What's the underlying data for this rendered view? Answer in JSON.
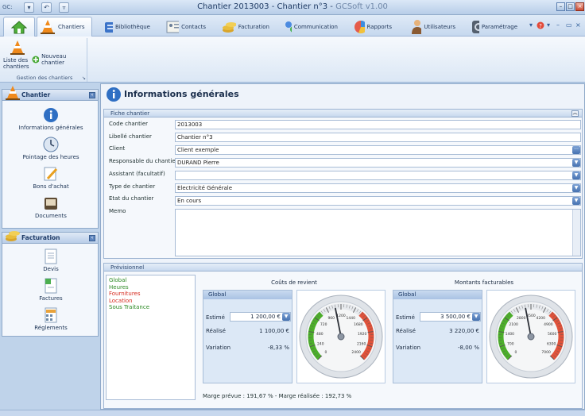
{
  "window": {
    "title": "Chantier 2013003 - Chantier n°3",
    "app_version": "GCSoft v1.00"
  },
  "quick_access": {
    "left_label": "GC:"
  },
  "tabs": [
    {
      "label": "",
      "icon": "home-icon"
    },
    {
      "label": "Chantiers",
      "icon": "cone-icon"
    },
    {
      "label": "Bibliothèque",
      "icon": "library-icon"
    },
    {
      "label": "Contacts",
      "icon": "contacts-icon"
    },
    {
      "label": "Facturation",
      "icon": "coins-icon"
    },
    {
      "label": "Communication",
      "icon": "communication-icon"
    },
    {
      "label": "Rapports",
      "icon": "reports-icon"
    },
    {
      "label": "Utilisateurs",
      "icon": "user-icon"
    },
    {
      "label": "Paramétrage",
      "icon": "settings-icon"
    }
  ],
  "ribbon": {
    "list_button": "Liste des chantiers",
    "new_button": "Nouveau chantier",
    "group_label": "Gestion des chantiers"
  },
  "nav": {
    "chantier_header": "Chantier",
    "chantier_items": [
      "Informations générales",
      "Pointage des heures",
      "Bons d'achat",
      "Documents"
    ],
    "facturation_header": "Facturation",
    "facturation_items": [
      "Devis",
      "Factures",
      "Réglements"
    ]
  },
  "main": {
    "title": "Informations générales",
    "fiche_header": "Fiche chantier",
    "fields": [
      {
        "label": "Code chantier",
        "value": "2013003"
      },
      {
        "label": "Libellé chantier",
        "value": "Chantier n°3"
      },
      {
        "label": "Client",
        "value": "Client exemple"
      },
      {
        "label": "Responsable du chantier",
        "value": "DURAND Pierre"
      },
      {
        "label": "Assistant (facultatif)",
        "value": ""
      },
      {
        "label": "Type de chantier",
        "value": "Electricité Générale"
      },
      {
        "label": "Etat du chantier",
        "value": "En cours"
      }
    ],
    "memo_label": "Memo",
    "previsionnel_header": "Prévisionnel",
    "previsionnel_items": [
      {
        "label": "Global",
        "color": "#2c8a24"
      },
      {
        "label": "Heures",
        "color": "#2c8a24"
      },
      {
        "label": "Fournitures",
        "color": "#d62b1f"
      },
      {
        "label": "Location",
        "color": "#d62b1f"
      },
      {
        "label": "Sous Traitance",
        "color": "#2c8a24"
      }
    ],
    "couts": {
      "title": "Coûts de revient",
      "panel_header": "Global",
      "estime_label": "Estimé",
      "estime_value": "1 200,00 €",
      "realise_label": "Réalisé",
      "realise_value": "1 100,00 €",
      "variation_label": "Variation",
      "variation_value": "-8,33 %",
      "gauge_ticks": [
        "0",
        "240",
        "480",
        "720",
        "960",
        "1200",
        "1440",
        "1680",
        "1920",
        "2160",
        "2400"
      ],
      "gauge_value": 1100,
      "gauge_max": 2400
    },
    "montants": {
      "title": "Montants facturables",
      "panel_header": "Global",
      "estime_label": "Estimé",
      "estime_value": "3 500,00 €",
      "realise_label": "Réalisé",
      "realise_value": "3 220,00 €",
      "variation_label": "Variation",
      "variation_value": "-8,00 %",
      "gauge_ticks": [
        "0",
        "700",
        "1400",
        "2100",
        "2800",
        "3500",
        "4200",
        "4900",
        "5600",
        "6300",
        "7000"
      ],
      "gauge_value": 3220,
      "gauge_max": 7000
    },
    "marge_text": "Marge prévue : 191,67 % - Marge réalisée : 192,73 %"
  },
  "colors": {
    "accent": "#2f5d9a",
    "green": "#4caf2a",
    "red": "#e0523a"
  }
}
